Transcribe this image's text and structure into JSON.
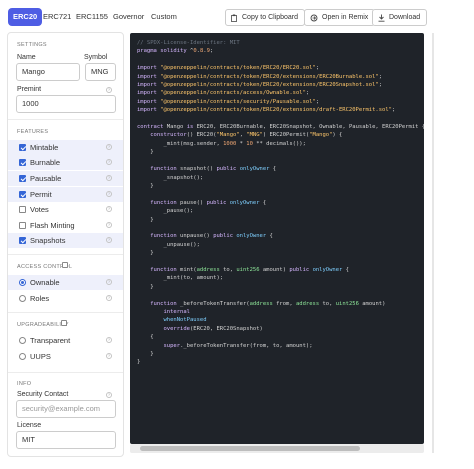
{
  "tabs": [
    {
      "label": "ERC20",
      "active": true
    },
    {
      "label": "ERC721",
      "active": false
    },
    {
      "label": "ERC1155",
      "active": false
    },
    {
      "label": "Governor",
      "active": false
    },
    {
      "label": "Custom",
      "active": false
    }
  ],
  "toolbar": {
    "copy_label": "Copy to Clipboard",
    "remix_label": "Open in Remix",
    "download_label": "Download"
  },
  "settings": {
    "title": "SETTINGS",
    "name_label": "Name",
    "name_value": "Mango",
    "symbol_label": "Symbol",
    "symbol_value": "MNG",
    "premint_label": "Premint",
    "premint_value": "1000"
  },
  "features": {
    "title": "FEATURES",
    "items": [
      {
        "label": "Mintable",
        "checked": true
      },
      {
        "label": "Burnable",
        "checked": true
      },
      {
        "label": "Pausable",
        "checked": true
      },
      {
        "label": "Permit",
        "checked": true
      },
      {
        "label": "Votes",
        "checked": false
      },
      {
        "label": "Flash Minting",
        "checked": false
      },
      {
        "label": "Snapshots",
        "checked": true
      }
    ]
  },
  "access_control": {
    "title": "ACCESS CONTROL",
    "enabled": false,
    "options": [
      {
        "label": "Ownable",
        "selected": true
      },
      {
        "label": "Roles",
        "selected": false
      }
    ]
  },
  "upgradeability": {
    "title": "UPGRADEABILITY",
    "enabled": false,
    "options": [
      {
        "label": "Transparent",
        "selected": false
      },
      {
        "label": "UUPS",
        "selected": false
      }
    ]
  },
  "info": {
    "title": "INFO",
    "contact_label": "Security Contact",
    "contact_placeholder": "security@example.com",
    "license_label": "License",
    "license_value": "MIT"
  },
  "colors": {
    "accent": "#4e5de4",
    "check": "#3566d6",
    "code_bg": "#1f2329"
  },
  "code": {
    "lines": [
      "// SPDX-License-Identifier: MIT",
      "pragma solidity ^0.8.9;",
      "",
      "import \"@openzeppelin/contracts/token/ERC20/ERC20.sol\";",
      "import \"@openzeppelin/contracts/token/ERC20/extensions/ERC20Burnable.sol\";",
      "import \"@openzeppelin/contracts/token/ERC20/extensions/ERC20Snapshot.sol\";",
      "import \"@openzeppelin/contracts/access/Ownable.sol\";",
      "import \"@openzeppelin/contracts/security/Pausable.sol\";",
      "import \"@openzeppelin/contracts/token/ERC20/extensions/draft-ERC20Permit.sol\";",
      "",
      "contract Mango is ERC20, ERC20Burnable, ERC20Snapshot, Ownable, Pausable, ERC20Permit {",
      "    constructor() ERC20(\"Mango\", \"MNG\") ERC20Permit(\"Mango\") {",
      "        _mint(msg.sender, 1000 * 10 ** decimals());",
      "    }",
      "",
      "    function snapshot() public onlyOwner {",
      "        _snapshot();",
      "    }",
      "",
      "    function pause() public onlyOwner {",
      "        _pause();",
      "    }",
      "",
      "    function unpause() public onlyOwner {",
      "        _unpause();",
      "    }",
      "",
      "    function mint(address to, uint256 amount) public onlyOwner {",
      "        _mint(to, amount);",
      "    }",
      "",
      "    function _beforeTokenTransfer(address from, address to, uint256 amount)",
      "        internal",
      "        whenNotPaused",
      "        override(ERC20, ERC20Snapshot)",
      "    {",
      "        super._beforeTokenTransfer(from, to, amount);",
      "    }",
      "}"
    ]
  }
}
